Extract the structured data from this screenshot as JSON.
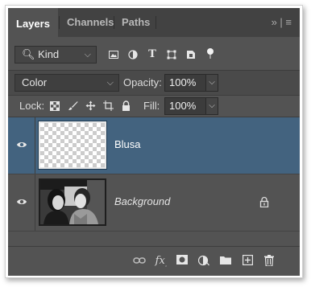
{
  "tabs": [
    {
      "label": "Layers",
      "active": true
    },
    {
      "label": "Channels",
      "active": false
    },
    {
      "label": "Paths",
      "active": false
    }
  ],
  "tab_menu_glyph": "» | ≡",
  "filter": {
    "kind_label": "Kind",
    "icons": [
      "image-filter-icon",
      "adjustment-filter-icon",
      "type-filter-icon",
      "shape-filter-icon",
      "smart-object-filter-icon",
      "filter-toggle-icon"
    ]
  },
  "blend": {
    "mode": "Color",
    "opacity_label": "Opacity:",
    "opacity_value": "100%"
  },
  "locks": {
    "label": "Lock:",
    "fill_label": "Fill:",
    "fill_value": "100%",
    "icons": [
      "lock-transparent-pixels-icon",
      "lock-image-pixels-icon",
      "lock-position-icon",
      "lock-artboard-icon",
      "lock-all-icon"
    ]
  },
  "layers": [
    {
      "name": "Blusa",
      "selected": true,
      "visible": true,
      "locked": false,
      "thumbnail": "transparent"
    },
    {
      "name": "Background",
      "selected": false,
      "visible": true,
      "locked": true,
      "thumbnail": "photo"
    }
  ],
  "bottom_icons": [
    "link-layers-icon",
    "fx-icon",
    "layer-mask-icon",
    "adjustment-layer-icon",
    "new-group-icon",
    "new-layer-icon",
    "delete-layer-icon"
  ],
  "colors": {
    "panel_bg": "#535353",
    "tabbar_bg": "#424242",
    "selected_layer": "#43637f"
  }
}
